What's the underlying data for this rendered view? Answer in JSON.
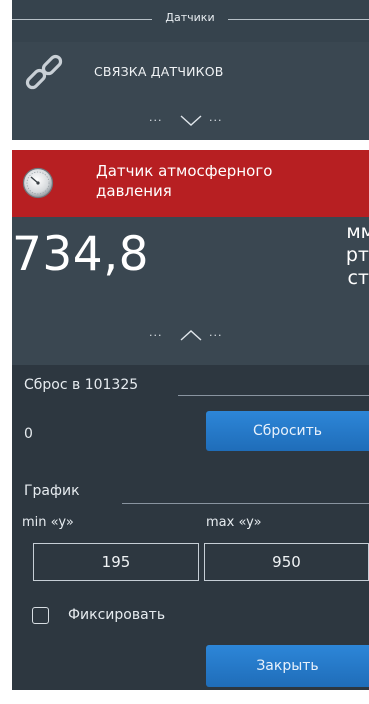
{
  "sensors_header": {
    "title": "Датчики"
  },
  "sensor_link": {
    "label": "СВЯЗКА ДАТЧИКОВ",
    "icon": "chain-link-icon"
  },
  "expander_top": {
    "dots_left": "···",
    "dots_right": "···",
    "icon": "chevron-down-icon"
  },
  "active_sensor": {
    "title": "Датчик атмосферного давления",
    "icon": "gauge-icon",
    "background_color": "#b71f22"
  },
  "reading": {
    "value": "734,8",
    "unit_line1": "мм",
    "unit_line2": "рт.",
    "unit_line3": "ст."
  },
  "expander_bottom": {
    "dots_left": "···",
    "dots_right": "···",
    "icon": "chevron-up-icon"
  },
  "settings": {
    "reset_label": "Сброс в 101325",
    "reset_value": "0",
    "reset_button": "Сбросить",
    "graph_label": "График",
    "min_label": "min «y»",
    "max_label": "max «y»",
    "min_value": "195",
    "max_value": "950",
    "fix_label": "Фиксировать",
    "fix_checked": false,
    "close_button": "Закрыть",
    "button_color": "#2277c8"
  }
}
